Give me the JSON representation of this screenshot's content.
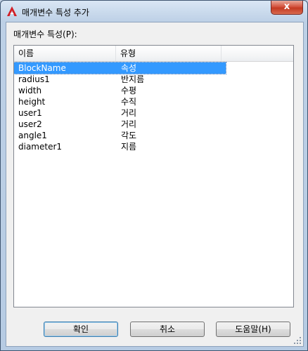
{
  "window": {
    "title": "매개변수 특성 추가",
    "close_label": "x"
  },
  "group": {
    "label": "매개변수 특성(P):"
  },
  "list": {
    "columns": [
      "이름",
      "유형"
    ],
    "rows": [
      {
        "name": "BlockName",
        "type": "속성",
        "selected": true
      },
      {
        "name": "radius1",
        "type": "반지름"
      },
      {
        "name": "width",
        "type": "수평"
      },
      {
        "name": "height",
        "type": "수직"
      },
      {
        "name": "user1",
        "type": "거리"
      },
      {
        "name": "user2",
        "type": "거리"
      },
      {
        "name": "angle1",
        "type": "각도"
      },
      {
        "name": "diameter1",
        "type": "지름"
      }
    ]
  },
  "buttons": {
    "ok": "확인",
    "cancel": "취소",
    "help": "도움말(H)"
  },
  "colors": {
    "selection": "#3399ff",
    "close": "#c43a22",
    "app_icon": "#d21f26"
  },
  "icons": {
    "app": "autocad-a-icon",
    "close": "close-icon",
    "grip": "resize-grip-icon"
  }
}
